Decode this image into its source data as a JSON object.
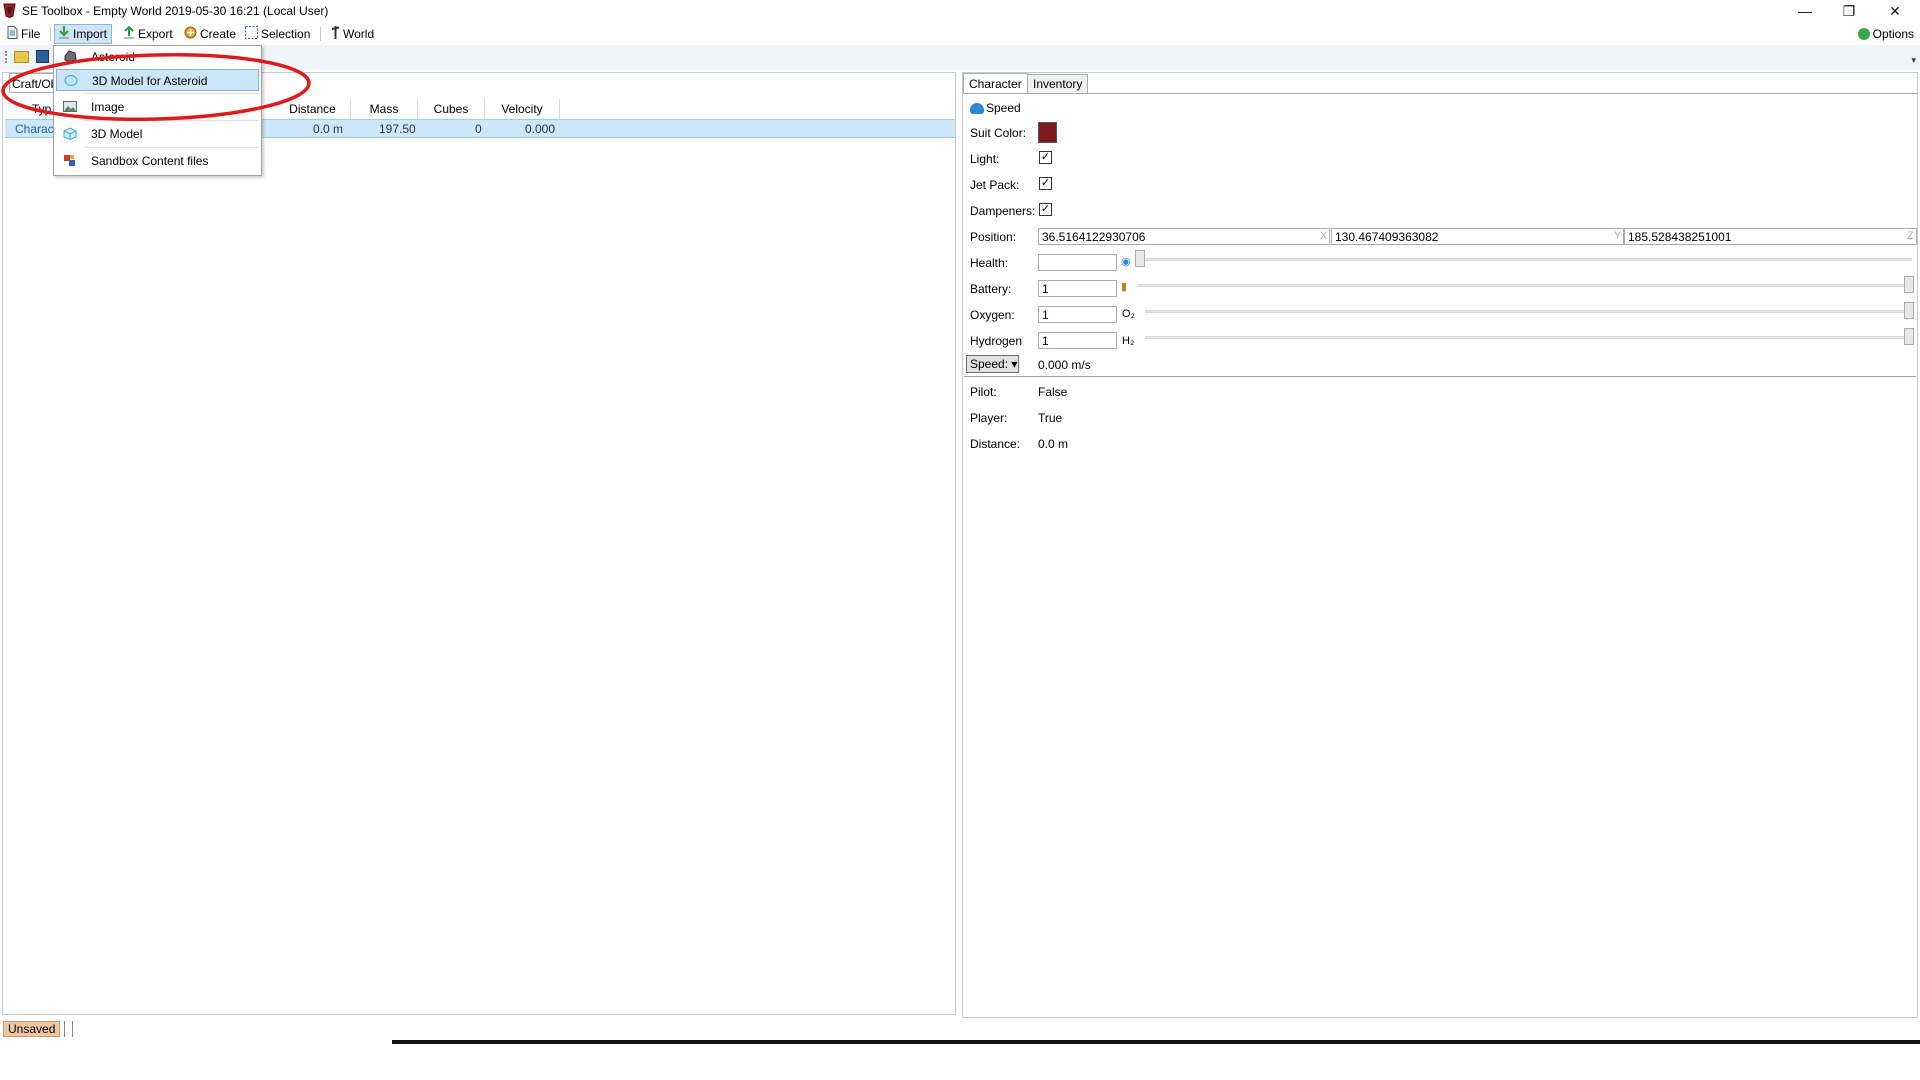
{
  "window": {
    "title": "SE Toolbox - Empty World 2019-05-30 16:21 (Local User)",
    "controls": {
      "minimize": "—",
      "maximize": "❐",
      "close": "✕"
    }
  },
  "menubar": {
    "items": [
      {
        "label": "File",
        "icon": "file-icon"
      },
      {
        "label": "Import",
        "icon": "import-icon"
      },
      {
        "label": "Export",
        "icon": "export-icon"
      },
      {
        "label": "Create",
        "icon": "create-icon"
      },
      {
        "label": "Selection",
        "icon": "selection-icon"
      },
      {
        "label": "World",
        "icon": "world-icon"
      }
    ],
    "options_label": "Options"
  },
  "import_menu": {
    "items": [
      {
        "label": "Asteroid",
        "icon": "asteroid-icon"
      },
      {
        "label": "3D Model for Asteroid",
        "icon": "asteroid-model-icon"
      },
      {
        "label": "Image",
        "icon": "image-icon"
      },
      {
        "label": "3D Model",
        "icon": "cube-icon"
      },
      {
        "label": "Sandbox Content files",
        "icon": "sandbox-icon"
      }
    ],
    "highlighted": "3D Model for Asteroid"
  },
  "left_panel": {
    "path": "Craft/Ob",
    "columns": [
      "Typ",
      "Distance",
      "Mass",
      "Cubes",
      "Velocity"
    ],
    "rows": [
      {
        "type": "Charact",
        "distance": "0.0 m",
        "mass": "197.50",
        "cubes": "0",
        "velocity": "0.000"
      }
    ]
  },
  "right_panel": {
    "tabs": [
      "Character",
      "Inventory"
    ],
    "speed_header": "Speed",
    "suit_color_label": "Suit Color:",
    "suit_color": "#7b1a1f",
    "light_label": "Light:",
    "light_checked": "✓",
    "jetpack_label": "Jet Pack:",
    "jetpack_checked": "✓",
    "dampeners_label": "Dampeners:",
    "dampeners_checked": "✓",
    "position_label": "Position:",
    "position": {
      "x": "36.5164122930706",
      "y": "130.467409363082",
      "z": "185.528438251001",
      "x_tag": "X",
      "y_tag": "Y",
      "z_tag": "Z"
    },
    "health_label": "Health:",
    "health_value": "",
    "battery_label": "Battery:",
    "battery_value": "1",
    "oxygen_label": "Oxygen:",
    "oxygen_value": "1",
    "oxygen_unit": "O₂",
    "hydrogen_label": "Hydrogen",
    "hydrogen_value": "1",
    "hydrogen_unit": "H₂",
    "speed_button": "Speed: ▾",
    "speed_value": "0.000 m/s",
    "pilot_label": "Pilot:",
    "pilot_value": "False",
    "player_label": "Player:",
    "player_value": "True",
    "distance_label": "Distance:",
    "distance_value": "0.0 m"
  },
  "statusbar": {
    "status": "Unsaved"
  }
}
